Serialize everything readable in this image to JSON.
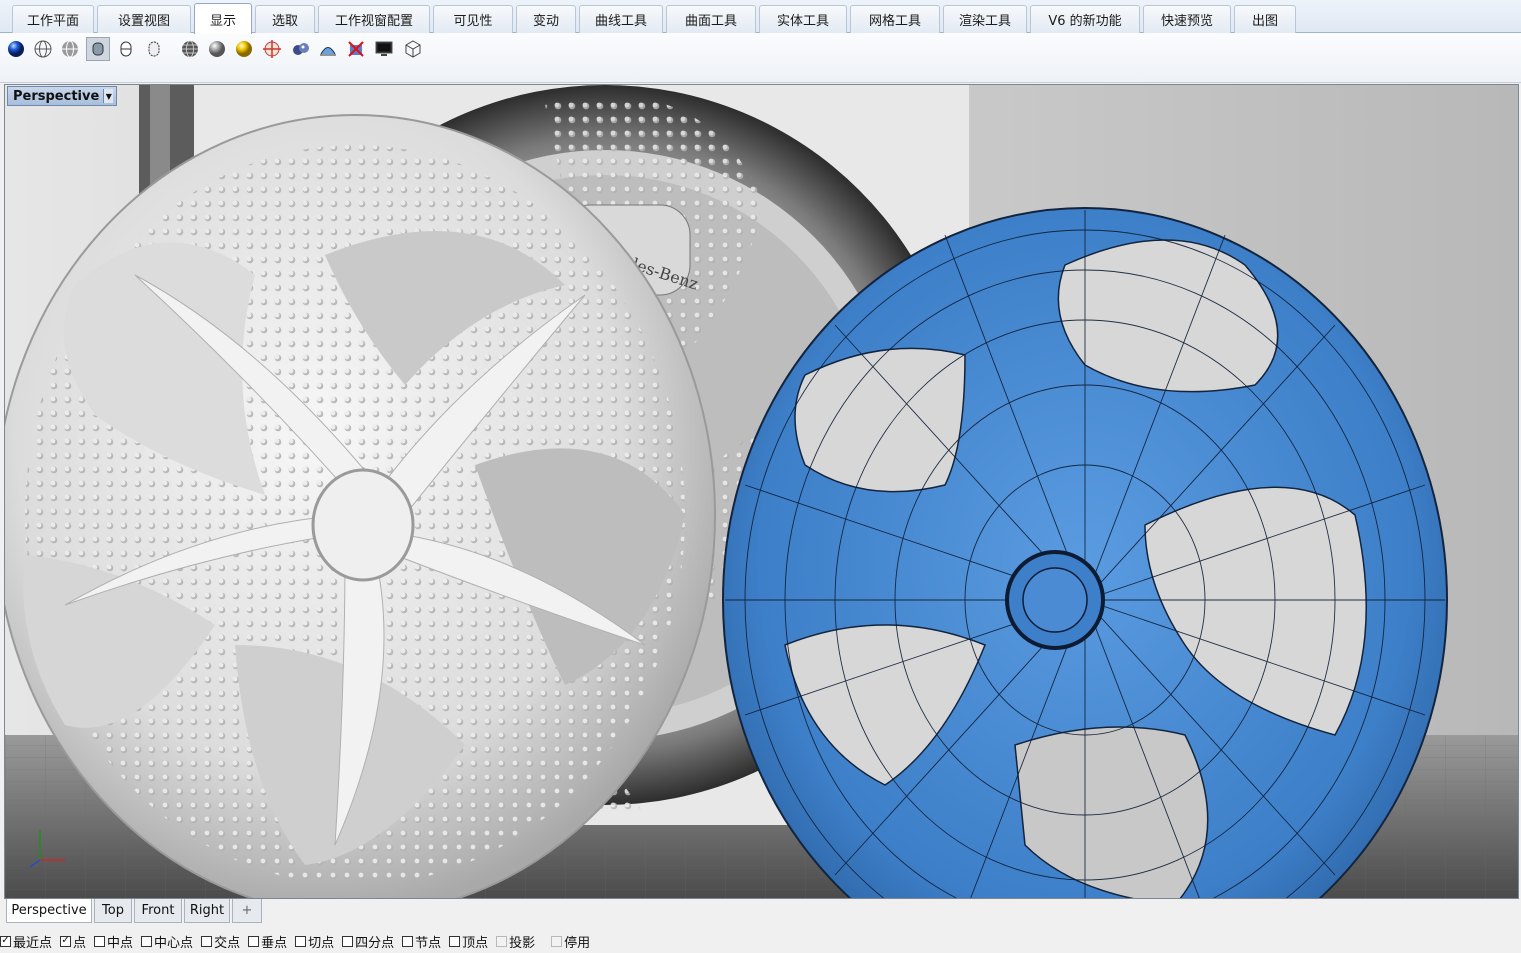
{
  "ribbon_tabs": [
    {
      "label": "工作平面"
    },
    {
      "label": "设置视图"
    },
    {
      "label": "显示",
      "active": true
    },
    {
      "label": "选取"
    },
    {
      "label": "工作视窗配置"
    },
    {
      "label": "可见性"
    },
    {
      "label": "变动"
    },
    {
      "label": "曲线工具"
    },
    {
      "label": "曲面工具"
    },
    {
      "label": "实体工具"
    },
    {
      "label": "网格工具"
    },
    {
      "label": "渲染工具"
    },
    {
      "label": "V6 的新功能"
    },
    {
      "label": "快速预览"
    },
    {
      "label": "出图"
    }
  ],
  "toolbar_icons": [
    "rendered-sphere-icon",
    "wireframe-sphere-icon",
    "ghosted-sphere-icon",
    "shaded-cylinder-icon",
    "capsule-outline-icon",
    "capsule-dotted-icon",
    "globe-grid-icon",
    "shaded-sphere-icon",
    "gold-sphere-icon",
    "zebra-sphere-icon",
    "environment-map-icon",
    "curvature-analysis-icon",
    "draft-angle-icon",
    "display-monitor-icon",
    "isometric-box-icon"
  ],
  "viewport": {
    "title": "Perspective",
    "dropdown_glyph": "▼",
    "decal_text": "Mercedes-Benz",
    "colors": {
      "wheel_blue": "#3d7fc8",
      "wheel_silver": "#d8d8d8",
      "background_grey": "#cfcfcf"
    }
  },
  "viewport_tabs": [
    {
      "label": "Perspective",
      "active": true
    },
    {
      "label": "Top"
    },
    {
      "label": "Front"
    },
    {
      "label": "Right"
    },
    {
      "label": "+"
    }
  ],
  "osnaps": [
    {
      "label": "最近点",
      "checked": true
    },
    {
      "label": "点",
      "checked": true
    },
    {
      "label": "中点",
      "checked": false
    },
    {
      "label": "中心点",
      "checked": false
    },
    {
      "label": "交点",
      "checked": false
    },
    {
      "label": "垂点",
      "checked": false
    },
    {
      "label": "切点",
      "checked": false
    },
    {
      "label": "四分点",
      "checked": false
    },
    {
      "label": "节点",
      "checked": false
    },
    {
      "label": "顶点",
      "checked": false
    },
    {
      "label": "投影",
      "checked": false,
      "disabled": true
    },
    {
      "label": "停用",
      "checked": false,
      "disabled": true
    }
  ]
}
